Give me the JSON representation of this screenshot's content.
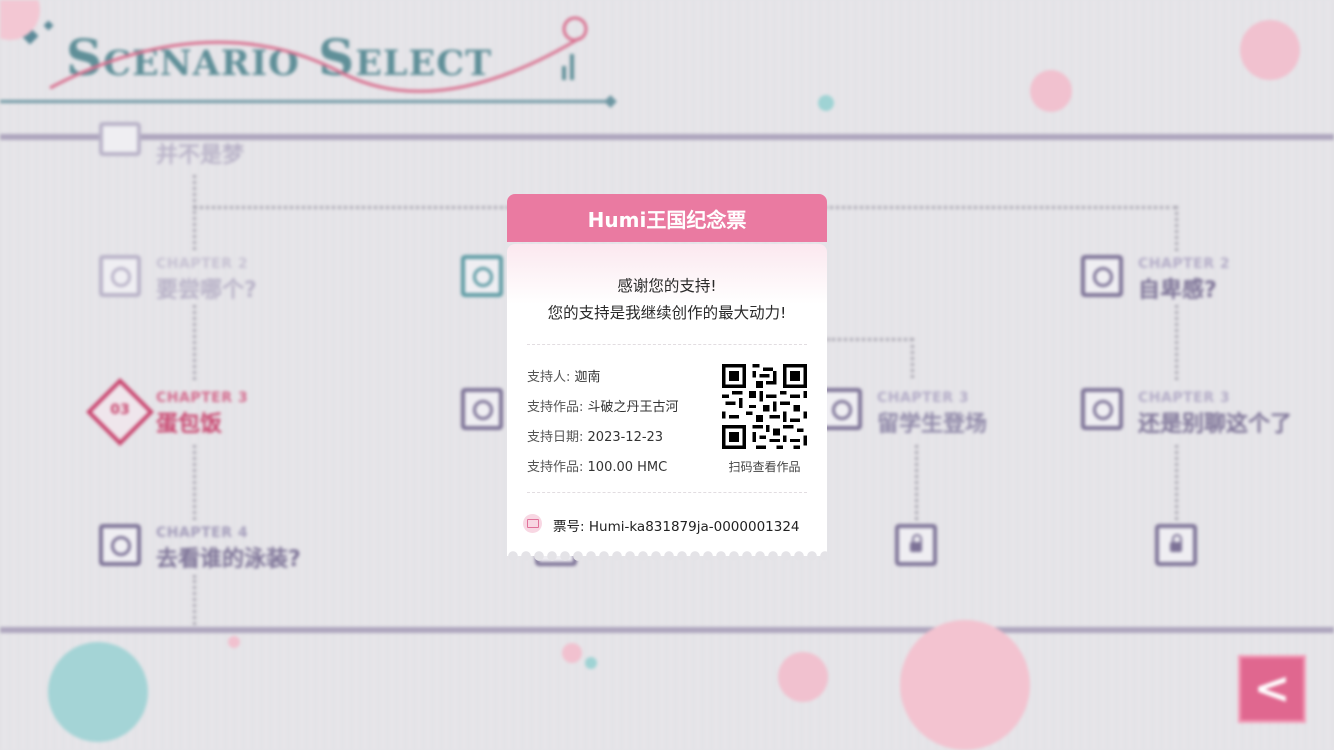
{
  "header": {
    "title": "Scenario Select"
  },
  "map_nodes": [
    {
      "chapter": "",
      "title": "并不是梦"
    },
    {
      "chapter": "CHAPTER 2",
      "title": "要尝哪个?"
    },
    {
      "chapter": "CHAPTER 3",
      "title": "蛋包饭",
      "number": "03"
    },
    {
      "chapter": "CHAPTER 4",
      "title": "去看谁的泳装?"
    },
    {
      "chapter": "CHAPTER 3",
      "title": "留学生登场"
    },
    {
      "chapter": "CHAPTER 2",
      "title": "自卑感?"
    },
    {
      "chapter": "CHAPTER 3",
      "title": "还是别聊这个了"
    }
  ],
  "ticket": {
    "title": "Humi王国纪念票",
    "thanks_line1": "感谢您的支持!",
    "thanks_line2": "您的支持是我继续创作的最大动力!",
    "rows": [
      {
        "label": "支持人:",
        "value": "迦南"
      },
      {
        "label": "支持作品:",
        "value": "斗破之丹王古河"
      },
      {
        "label": "支持日期:",
        "value": "2023-12-23"
      },
      {
        "label": "支持作品:",
        "value": "100.00 HMC"
      }
    ],
    "qr_caption": "扫码查看作品",
    "ticket_no_label": "票号:",
    "ticket_no": "Humi-ka831879ja-0000001324"
  },
  "back_button": {
    "icon": "chevron-left-icon",
    "label": "<"
  },
  "colors": {
    "accent_pink": "#ea7aa1",
    "teal": "#5f8f98",
    "purple": "#7d7397",
    "red": "#c9466f"
  }
}
